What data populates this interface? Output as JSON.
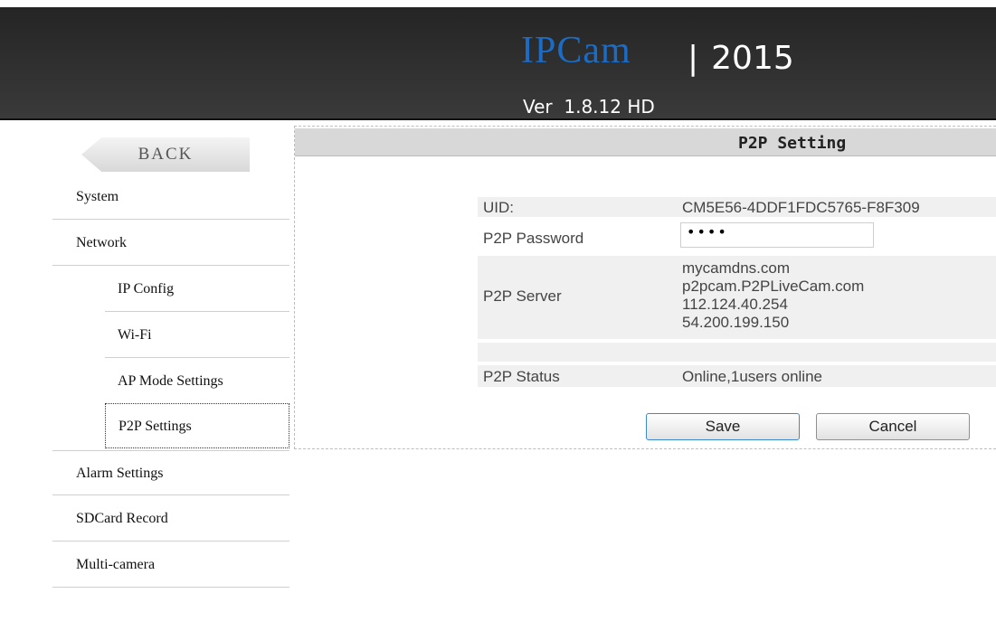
{
  "header": {
    "brand": "IPCam",
    "separator": "|",
    "year": "2015",
    "version": "Ver  1.8.12 HD"
  },
  "sidebar": {
    "back_label": "BACK",
    "items": [
      {
        "label": "System"
      },
      {
        "label": "Network"
      },
      {
        "label": "IP Config"
      },
      {
        "label": "Wi-Fi"
      },
      {
        "label": "AP Mode Settings"
      },
      {
        "label": "P2P Settings"
      },
      {
        "label": "Alarm Settings"
      },
      {
        "label": "SDCard Record"
      },
      {
        "label": "Multi-camera"
      }
    ]
  },
  "main": {
    "section_title": "P2P Setting",
    "uid_label": "UID:",
    "uid_value": "CM5E56-4DDF1FDC5765-F8F309",
    "password_label": "P2P Password",
    "password_value": "••••",
    "server_label": "P2P Server",
    "servers": [
      "mycamdns.com",
      "p2pcam.P2PLiveCam.com",
      "112.124.40.254",
      "54.200.199.150"
    ],
    "status_label": "P2P Status",
    "status_value": "Online,1users online",
    "save_label": "Save",
    "cancel_label": "Cancel"
  },
  "colors": {
    "brand_blue": "#1b6cc6",
    "header_bg": "#2b2b2b",
    "section_header_bg": "#d8d8d8"
  }
}
